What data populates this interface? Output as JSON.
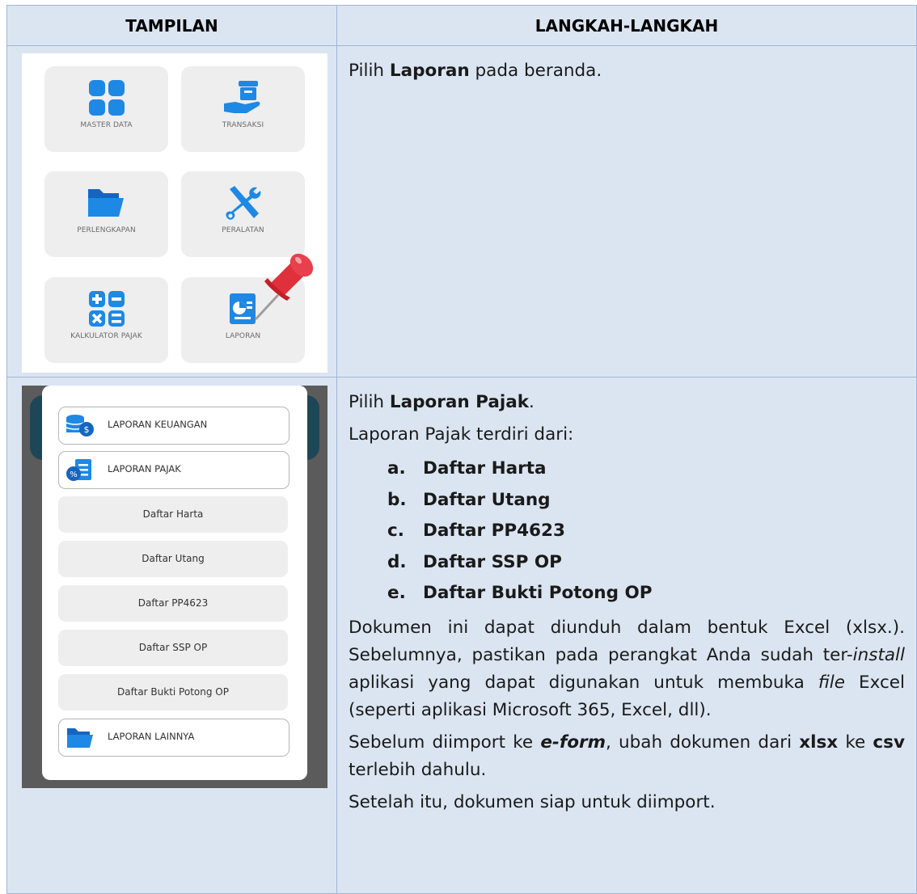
{
  "table": {
    "col1_header": "TAMPILAN",
    "col2_header": "LANGKAH-LANGKAH"
  },
  "screen1": {
    "tiles": [
      "MASTER DATA",
      "TRANSAKSI",
      "PERLENGKAPAN",
      "PERALATAN",
      "KALKULATOR PAJAK",
      "LAPORAN"
    ],
    "icons": [
      "grid-icon",
      "hand-box-icon",
      "folder-icon",
      "tools-icon",
      "calculator-icon",
      "report-icon",
      "pushpin-icon"
    ],
    "accent": "#1e88e5",
    "pin_color": "#e0303c"
  },
  "row1": {
    "pre": "Pilih ",
    "bold": "Laporan",
    "post": " pada beranda."
  },
  "screen2": {
    "main_items": [
      "LAPORAN KEUANGAN",
      "LAPORAN PAJAK",
      "LAPORAN LAINNYA"
    ],
    "sub_items": [
      "Daftar Harta",
      "Daftar Utang",
      "Daftar PP4623",
      "Daftar SSP OP",
      "Daftar Bukti Potong OP"
    ],
    "icons": [
      "coins-icon",
      "tax-doc-icon",
      "folder-icon"
    ]
  },
  "row2": {
    "p1_pre": "Pilih ",
    "p1_bold": "Laporan Pajak",
    "p1_post": ".",
    "p2": "Laporan Pajak terdiri dari:",
    "list": [
      {
        "letter": "a.",
        "text": "Daftar Harta"
      },
      {
        "letter": "b.",
        "text": "Daftar Utang"
      },
      {
        "letter": "c.",
        "text": "Daftar PP4623"
      },
      {
        "letter": "d.",
        "text": "Daftar SSP OP"
      },
      {
        "letter": "e.",
        "text": "Daftar Bukti Potong OP"
      }
    ],
    "p3_a": "Dokumen ini dapat diunduh dalam bentuk Excel (xlsx.). Sebelumnya, pastikan pada perangkat Anda sudah ter-",
    "p3_install": "install",
    "p3_b": " aplikasi yang dapat digunakan untuk membuka ",
    "p3_file": "file",
    "p3_c": " Excel (seperti aplikasi Microsoft 365, Excel, dll).",
    "p4_a": "Sebelum diimport ke ",
    "p4_eform": "e-form",
    "p4_b": ", ubah dokumen dari ",
    "p4_xlsx": "xlsx",
    "p4_c": " ke ",
    "p4_csv": "csv",
    "p4_d": " terlebih dahulu.",
    "p5": "Setelah itu, dokumen siap untuk diimport."
  }
}
